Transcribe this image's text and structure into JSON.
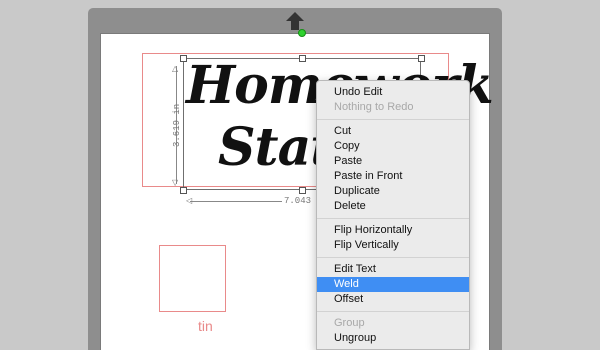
{
  "design": {
    "line1": "Homework",
    "line2": "Stati",
    "height_dimension": "3.619 in",
    "width_dimension": "7.043 in"
  },
  "tin": {
    "label": "tin"
  },
  "context_menu": {
    "groups": [
      [
        {
          "label": "Undo Edit",
          "enabled": true
        },
        {
          "label": "Nothing to Redo",
          "enabled": false
        }
      ],
      [
        {
          "label": "Cut",
          "enabled": true
        },
        {
          "label": "Copy",
          "enabled": true
        },
        {
          "label": "Paste",
          "enabled": true
        },
        {
          "label": "Paste in Front",
          "enabled": true
        },
        {
          "label": "Duplicate",
          "enabled": true
        },
        {
          "label": "Delete",
          "enabled": true
        }
      ],
      [
        {
          "label": "Flip Horizontally",
          "enabled": true
        },
        {
          "label": "Flip Vertically",
          "enabled": true
        }
      ],
      [
        {
          "label": "Edit Text",
          "enabled": true
        },
        {
          "label": "Weld",
          "enabled": true,
          "highlighted": true
        },
        {
          "label": "Offset",
          "enabled": true
        }
      ],
      [
        {
          "label": "Group",
          "enabled": false
        },
        {
          "label": "Ungroup",
          "enabled": true
        }
      ]
    ]
  },
  "colors": {
    "highlight": "#3f8ef3",
    "design_outline": "#e98a8a",
    "rotate_handle": "#2fd22f"
  }
}
